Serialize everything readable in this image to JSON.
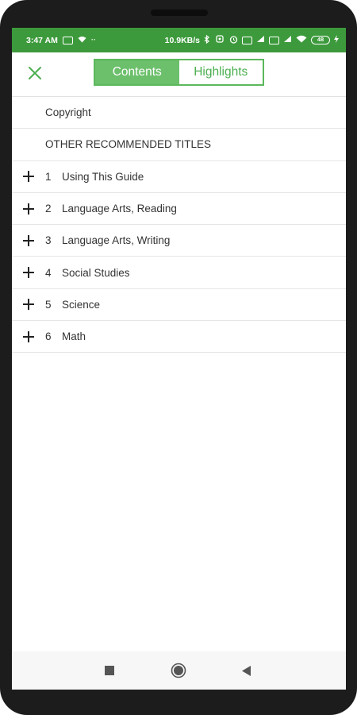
{
  "status_bar": {
    "time": "3:47 AM",
    "speed": "10.9KB/s",
    "battery": "48"
  },
  "header": {
    "tabs": [
      {
        "label": "Contents",
        "active": true
      },
      {
        "label": "Highlights",
        "active": false
      }
    ]
  },
  "toc": {
    "items": [
      {
        "number": "",
        "title": "Copyright",
        "expandable": false
      },
      {
        "number": "",
        "title": "OTHER RECOMMENDED TITLES",
        "expandable": false
      },
      {
        "number": "1",
        "title": "Using This Guide",
        "expandable": true
      },
      {
        "number": "2",
        "title": "Language Arts, Reading",
        "expandable": true
      },
      {
        "number": "3",
        "title": "Language Arts, Writing",
        "expandable": true
      },
      {
        "number": "4",
        "title": "Social Studies",
        "expandable": true
      },
      {
        "number": "5",
        "title": "Science",
        "expandable": true
      },
      {
        "number": "6",
        "title": "Math",
        "expandable": true
      }
    ]
  },
  "colors": {
    "status_bar": "#3d9a3c",
    "accent": "#5cb85c",
    "active_tab": "#6cbf6b"
  },
  "icons": {
    "close": "close-icon",
    "expand": "plus-icon",
    "nav_recents": "square-icon",
    "nav_home": "circle-icon",
    "nav_back": "triangle-back-icon"
  }
}
